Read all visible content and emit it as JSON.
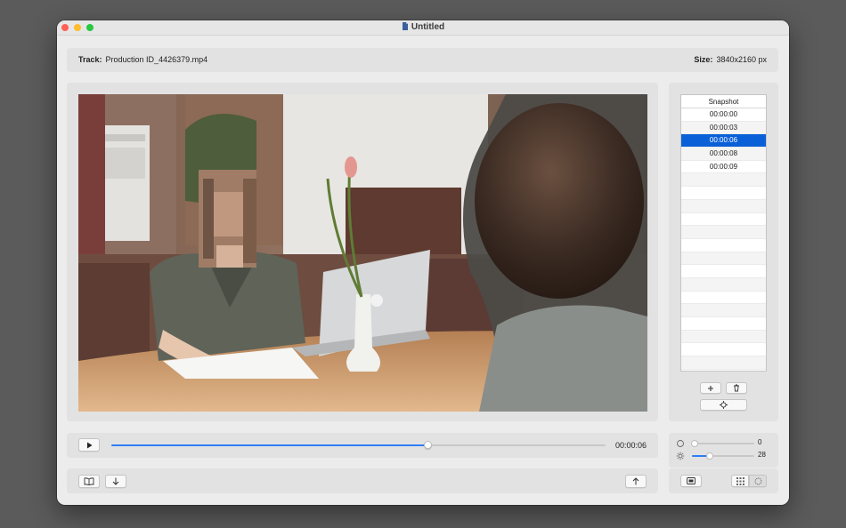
{
  "window": {
    "title": "Untitled"
  },
  "info": {
    "track_label": "Track:",
    "track_value": "Production ID_4426379.mp4",
    "size_label": "Size:",
    "size_value": "3840x2160 px"
  },
  "snapshots": {
    "header": "Snapshot",
    "items": [
      "00:00:00",
      "00:00:03",
      "00:00:06",
      "00:00:08",
      "00:00:09"
    ],
    "selected": "00:00:06",
    "add_icon": "plus-icon",
    "delete_icon": "trash-icon",
    "capture_icon": "target-icon"
  },
  "player": {
    "time": "00:00:06",
    "progress": 0.64,
    "play_icon": "play-icon"
  },
  "adjustments": {
    "contrast": {
      "value": "0",
      "level": 0.0,
      "icon": "circle-icon"
    },
    "brightness": {
      "value": "28",
      "level": 0.28,
      "icon": "sun-icon"
    }
  },
  "toolbar": {
    "book_icon": "book-icon",
    "download_icon": "arrow-down-icon",
    "export_icon": "arrow-up-icon",
    "mask_icon": "mask-icon",
    "blur_icon": "blur-icon",
    "pixelate_icon": "pixelate-icon"
  },
  "colors": {
    "accent": "#2f7df6",
    "selection": "#0a60d6"
  }
}
